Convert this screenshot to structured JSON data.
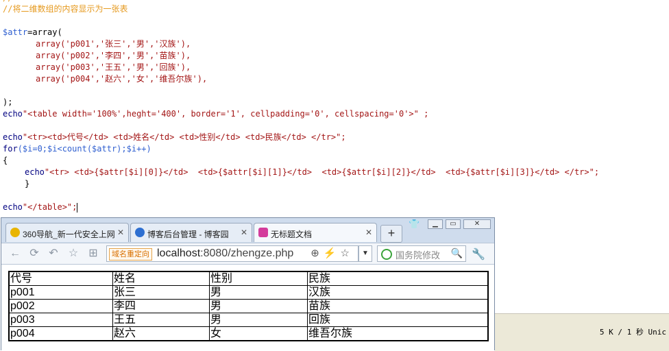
{
  "code": {
    "comment_line": "//将二维数组的内容显示为一张表",
    "line_attr_open_var": "$attr",
    "line_attr_open_rest": "=array(",
    "array_rows": [
      "array('p001','张三','男','汉族'),",
      "array('p002','李四','男','苗族'),",
      "array('p003','王五','男','回族'),",
      "array('p004','赵六','女','维吾尔族'),"
    ],
    "close_paren": ");",
    "echo_table_kw": "echo",
    "echo_table_str": "\"<table width='100%',heght='400', border='1', cellpadding='0', cellspacing='0'>\" ;",
    "echo_header_kw": "echo",
    "echo_header_str": "\"<tr><td>代号</td> <td>姓名</td> <td>性别</td> <td>民族</td> </tr>\";",
    "for_kw": "for",
    "for_rest": "($i=0;$i<count($attr);$i++)",
    "open_brace": "{",
    "echo_row_kw": "echo",
    "echo_row_str": "\"<tr> <td>{$attr[$i][0]}</td>  <td>{$attr[$i][1]}</td>  <td>{$attr[$i][2]}</td>  <td>{$attr[$i][3]}</td> </tr>\";",
    "close_brace": "}",
    "echo_end_kw": "echo",
    "echo_end_str": "\"</table>\";"
  },
  "status": {
    "text": "5 K / 1 秒  Unic"
  },
  "browser": {
    "tabs": [
      {
        "label": "360导航_新一代安全上网",
        "icon": "360-logo-icon",
        "color": "#e8b400"
      },
      {
        "label": "博客后台管理 - 博客园",
        "icon": "cnblogs-logo-icon",
        "color": "#2e6fd1"
      },
      {
        "label": "无标题文档",
        "icon": "page-icon",
        "color": "#d43c9c"
      }
    ],
    "new_tab_label": "+",
    "address": {
      "badge": "域名重定向",
      "host": "localhost",
      "path": ":8080/zhengze.php"
    },
    "search_placeholder": "国务院修改",
    "table": {
      "header": [
        "代号",
        "姓名",
        "性别",
        "民族"
      ],
      "rows": [
        [
          "p001",
          "张三",
          "男",
          "汉族"
        ],
        [
          "p002",
          "李四",
          "男",
          "苗族"
        ],
        [
          "p003",
          "王五",
          "男",
          "回族"
        ],
        [
          "p004",
          "赵六",
          "女",
          "维吾尔族"
        ]
      ]
    }
  }
}
